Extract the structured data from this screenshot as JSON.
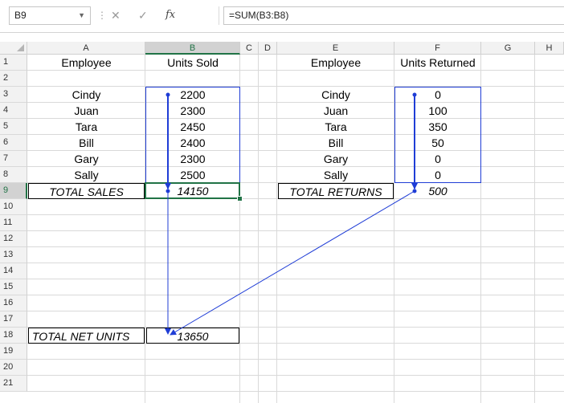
{
  "formula_bar": {
    "name_box": "B9",
    "name_box_arrow": "▼",
    "separator": "⋮",
    "cancel_icon": "✕",
    "enter_icon": "✓",
    "fx_icon": "fx",
    "formula": "=SUM(B3:B8)"
  },
  "columns": [
    "A",
    "B",
    "C",
    "D",
    "E",
    "F",
    "G",
    "H"
  ],
  "rows": [
    "1",
    "2",
    "3",
    "4",
    "5",
    "6",
    "7",
    "8",
    "9",
    "10",
    "11",
    "12",
    "13",
    "14",
    "15",
    "16",
    "17",
    "18",
    "19",
    "20",
    "21"
  ],
  "cells": {
    "A1": "Employee",
    "B1": "Units Sold",
    "E1": "Employee",
    "F1": "Units Returned",
    "A3": "Cindy",
    "B3": "2200",
    "E3": "Cindy",
    "F3": "0",
    "A4": "Juan",
    "B4": "2300",
    "E4": "Juan",
    "F4": "100",
    "A5": "Tara",
    "B5": "2450",
    "E5": "Tara",
    "F5": "350",
    "A6": "Bill",
    "B6": "2400",
    "E6": "Bill",
    "F6": "50",
    "A7": "Gary",
    "B7": "2300",
    "E7": "Gary",
    "F7": "0",
    "A8": "Sally",
    "B8": "2500",
    "E8": "Sally",
    "F8": "0",
    "A9": "TOTAL SALES",
    "B9": "14150",
    "E9": "TOTAL RETURNS",
    "F9": "500",
    "A18": "TOTAL NET UNITS",
    "B18": "13650"
  },
  "colors": {
    "selection": "#217346",
    "trace_arrow": "#1f3dd6"
  }
}
